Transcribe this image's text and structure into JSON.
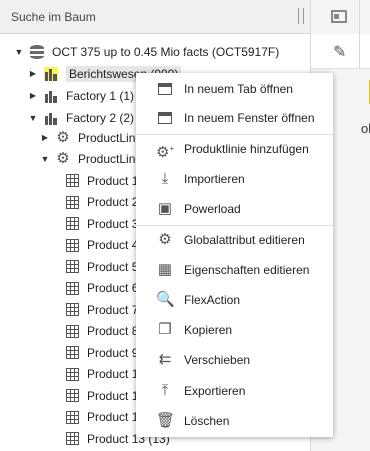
{
  "search": {
    "placeholder": "Suche im Baum"
  },
  "right_panel": {
    "text": "ol"
  },
  "tree": {
    "root": "OCT 375 up to 0.45 Mio facts (OCT5917F)",
    "nodes": [
      {
        "label": "Berichtswesen (999)"
      },
      {
        "label": "Factory 1 (1)"
      },
      {
        "label": "Factory 2 (2)"
      },
      {
        "label": "ProductLine"
      },
      {
        "label": "ProductLine"
      }
    ],
    "products": [
      "Product 1",
      "Product 2",
      "Product 3",
      "Product 4",
      "Product 5",
      "Product 6",
      "Product 7",
      "Product 8",
      "Product 9",
      "Product 1",
      "Product 1",
      "Product 1",
      "Product 13 (13)"
    ]
  },
  "menu": {
    "items": [
      {
        "label": "In neuem Tab öffnen",
        "icon": "tab-icon"
      },
      {
        "label": "In neuem Fenster öffnen",
        "icon": "window-icon"
      },
      {
        "label": "Produktlinie hinzufügen",
        "icon": "gear-add-icon"
      },
      {
        "label": "Importieren",
        "icon": "import-icon"
      },
      {
        "label": "Powerload",
        "icon": "powerload-icon"
      },
      {
        "label": "Globalattribut editieren",
        "icon": "gear-icon"
      },
      {
        "label": "Eigenschaften editieren",
        "icon": "properties-icon"
      },
      {
        "label": "FlexAction",
        "icon": "search-icon"
      },
      {
        "label": "Kopieren",
        "icon": "copy-icon"
      },
      {
        "label": "Verschieben",
        "icon": "move-icon"
      },
      {
        "label": "Exportieren",
        "icon": "export-icon"
      },
      {
        "label": "Löschen",
        "icon": "trash-icon"
      }
    ]
  }
}
